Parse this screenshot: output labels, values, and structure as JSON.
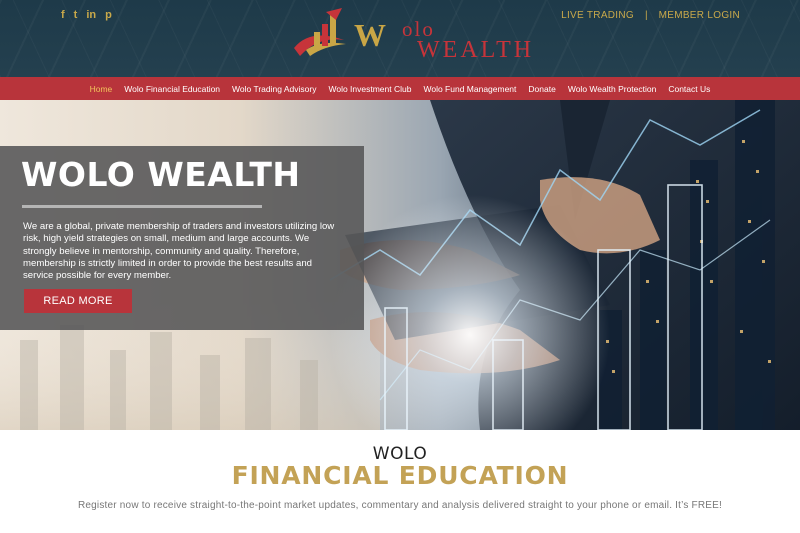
{
  "header": {
    "social": [
      {
        "icon": "facebook-icon",
        "glyph": "f"
      },
      {
        "icon": "twitter-icon",
        "glyph": "t"
      },
      {
        "icon": "linkedin-icon",
        "glyph": "in"
      },
      {
        "icon": "pinterest-icon",
        "glyph": "p"
      }
    ],
    "logo": {
      "word1": "W",
      "word1_rest": "olo",
      "word2": "WEALTH"
    },
    "live_trading": "LIVE TRADING",
    "separator": "|",
    "member_login": "MEMBER LOGIN"
  },
  "nav": {
    "items": [
      "Home",
      "Wolo Financial Education",
      "Wolo Trading Advisory",
      "Wolo Investment Club",
      "Wolo Fund Management",
      "Donate",
      "Wolo Wealth Protection",
      "Contact Us"
    ],
    "active": "Home"
  },
  "hero": {
    "title": "WOLO WEALTH",
    "text": "We are a global, private membership of traders and investors utilizing low risk, high yield strategies on small, medium and large accounts. We strongly believe in mentorship, community and quality. Therefore, membership is strictly limited in order to provide the best results and service possible for every member.",
    "button": "READ MORE"
  },
  "section": {
    "kicker": "WOLO",
    "heading": "FINANCIAL EDUCATION",
    "text": "Register now to receive straight-to-the-point market updates, commentary and analysis delivered straight to your phone or email. It’s FREE!"
  },
  "colors": {
    "header_bg": "#1e3a49",
    "nav_bg": "#b8343b",
    "gold": "#c9a94a",
    "active_nav": "#f1c35b",
    "button": "#b8343b"
  }
}
